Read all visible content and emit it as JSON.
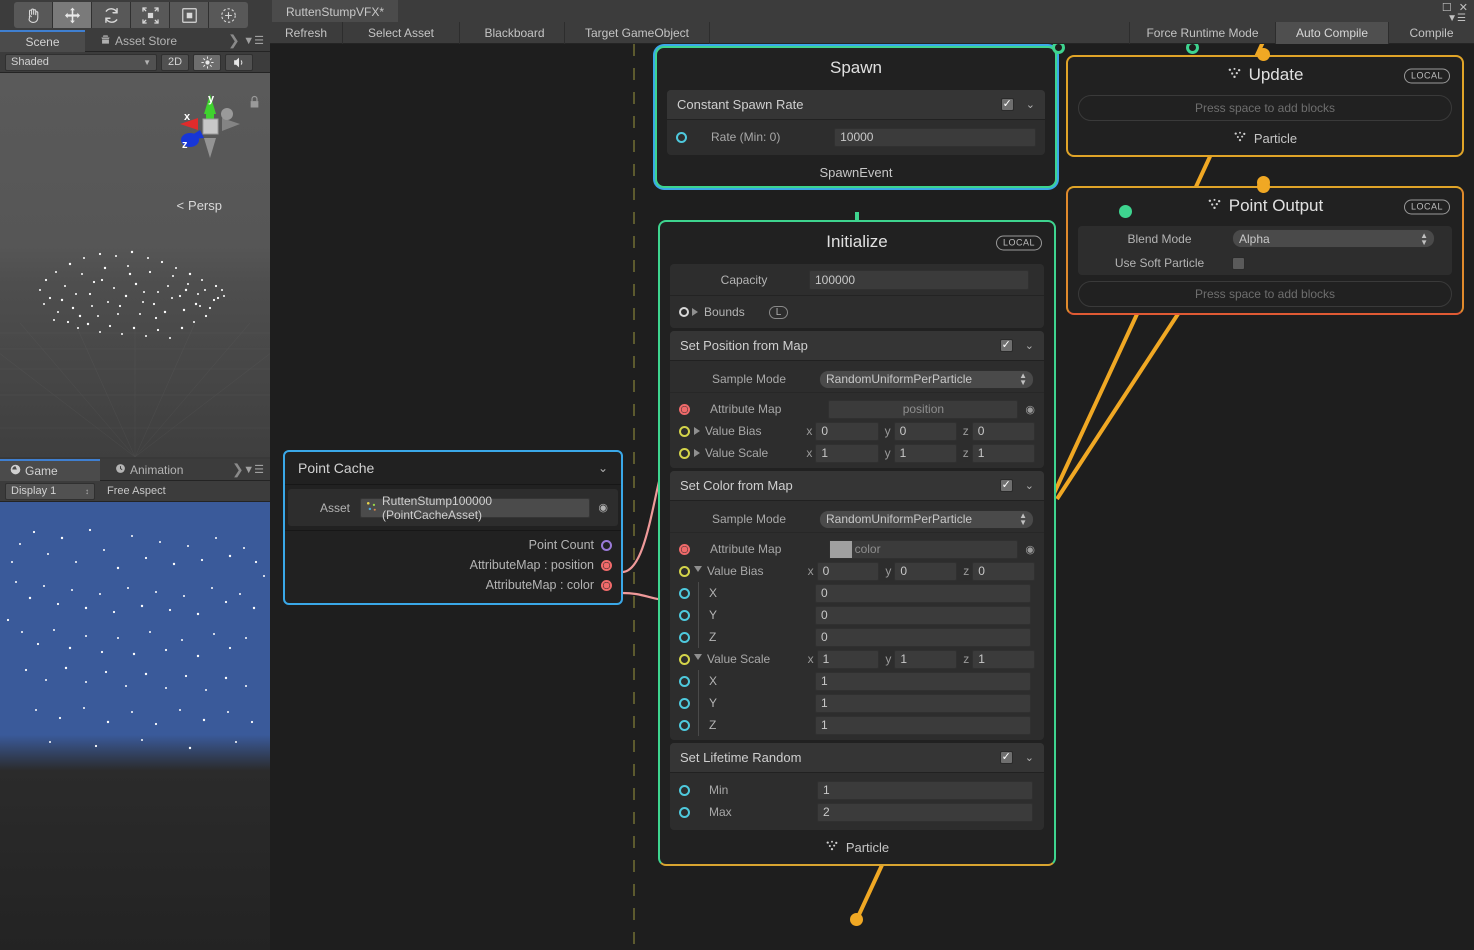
{
  "window": {
    "vfx_tab_title": "RuttenStumpVFX*",
    "toolbar_left": [
      "Refresh",
      "Select Asset",
      "Blackboard",
      "Target GameObject"
    ],
    "toolbar_right": [
      {
        "label": "Force Runtime Mode",
        "toggled": false
      },
      {
        "label": "Auto Compile",
        "toggled": true
      },
      {
        "label": "Compile",
        "toggled": false
      }
    ]
  },
  "unity_toolbar": {
    "tools": [
      {
        "name": "hand-tool",
        "active": false
      },
      {
        "name": "move-tool",
        "active": true
      },
      {
        "name": "rotate-tool",
        "active": false
      },
      {
        "name": "scale-tool",
        "active": false
      },
      {
        "name": "rect-tool",
        "active": false
      },
      {
        "name": "transform-tool",
        "active": false
      }
    ]
  },
  "scene_panel": {
    "tabs": [
      {
        "label": "Scene",
        "active": true,
        "icon": ""
      },
      {
        "label": "Asset Store",
        "active": false,
        "icon": "store-icon"
      }
    ],
    "shading_mode": "Shaded",
    "button_2d": "2D",
    "lighting_icon": "lighting-icon",
    "audio_icon": "audio-icon",
    "gizmo_axes": [
      "x",
      "y",
      "z"
    ],
    "projection_label": "Persp"
  },
  "game_panel": {
    "tabs": [
      {
        "label": "Game",
        "active": true,
        "icon": "game-icon"
      },
      {
        "label": "Animation",
        "active": false,
        "icon": "clock-icon"
      }
    ],
    "display": "Display 1",
    "aspect": "Free Aspect"
  },
  "nodes": {
    "spawn": {
      "title": "Spawn",
      "block": {
        "title": "Constant Spawn Rate",
        "enabled": true,
        "rows": [
          {
            "label": "Rate (Min: 0)",
            "value": "10000",
            "port": "cyan"
          }
        ]
      },
      "footer": "SpawnEvent"
    },
    "initialize": {
      "title": "Initialize",
      "badge": "LOCAL",
      "settings": [
        {
          "label": "Capacity",
          "value": "100000"
        },
        {
          "label": "Bounds",
          "value": "",
          "space_badge": "L"
        }
      ],
      "blocks": [
        {
          "title": "Set Position from Map",
          "enabled": true,
          "sample_mode_label": "Sample Mode",
          "sample_mode_value": "RandomUniformPerParticle",
          "attribute_map_label": "Attribute Map",
          "attribute_map_value": "position",
          "attribute_map_has_swatch": false,
          "value_bias_label": "Value Bias",
          "value_bias": {
            "x": "0",
            "y": "0",
            "z": "0"
          },
          "value_scale_label": "Value Scale",
          "value_scale": {
            "x": "1",
            "y": "1",
            "z": "1"
          },
          "expanded": false
        },
        {
          "title": "Set Color from Map",
          "enabled": true,
          "sample_mode_label": "Sample Mode",
          "sample_mode_value": "RandomUniformPerParticle",
          "attribute_map_label": "Attribute Map",
          "attribute_map_value": "color",
          "attribute_map_has_swatch": true,
          "value_bias_label": "Value Bias",
          "value_bias": {
            "x": "0",
            "y": "0",
            "z": "0"
          },
          "value_scale_label": "Value Scale",
          "value_scale": {
            "x": "1",
            "y": "1",
            "z": "1"
          },
          "expanded": true,
          "components": [
            "X",
            "Y",
            "Z"
          ]
        },
        {
          "title": "Set Lifetime Random",
          "enabled": true,
          "rows": [
            {
              "label": "Min",
              "value": "1"
            },
            {
              "label": "Max",
              "value": "2"
            }
          ]
        }
      ],
      "footer": "Particle"
    },
    "update": {
      "title": "Update",
      "badge": "LOCAL",
      "placeholder": "Press space to add blocks",
      "footer": "Particle"
    },
    "point_output": {
      "title": "Point Output",
      "badge": "LOCAL",
      "settings": [
        {
          "label": "Blend Mode",
          "value": "Alpha",
          "type": "dropdown"
        },
        {
          "label": "Use Soft Particle",
          "value": "",
          "type": "checkbox",
          "checked": false
        }
      ],
      "placeholder": "Press space to add blocks"
    },
    "point_cache": {
      "title": "Point Cache",
      "asset_label": "Asset",
      "asset_value": "RuttenStump100000 (PointCacheAsset)",
      "outputs": [
        {
          "label": "Point Count",
          "port": "purple"
        },
        {
          "label": "AttributeMap : position",
          "port": "red"
        },
        {
          "label": "AttributeMap : color",
          "port": "red"
        }
      ]
    }
  },
  "colors": {
    "spawn_border": "#3ed48f",
    "initialize_border": "#3ed48f",
    "update_border": "#e0a428",
    "output_border_top": "#e0a428",
    "output_border_bottom": "#e05a34",
    "point_cache_border": "#3aa8e8",
    "edge_flow": "#f0a824",
    "edge_data": "#f09a9a",
    "selection": "#3aa8e8"
  }
}
